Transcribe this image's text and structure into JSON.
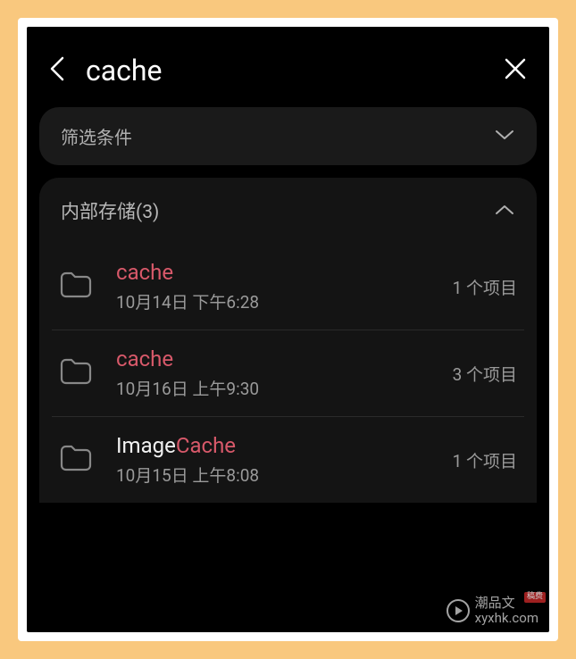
{
  "search": {
    "query": "cache"
  },
  "filter": {
    "label": "筛选条件"
  },
  "storage": {
    "title_prefix": "内部存储",
    "count": "(3)",
    "items": [
      {
        "name_prefix": "",
        "name_highlight": "cache",
        "name_suffix": "",
        "date": "10月14日 下午6:28",
        "count": "1 个项目"
      },
      {
        "name_prefix": "",
        "name_highlight": "cache",
        "name_suffix": "",
        "date": "10月16日 上午9:30",
        "count": "3 个项目"
      },
      {
        "name_prefix": "Image",
        "name_highlight": "Cache",
        "name_suffix": "",
        "date": "10月15日 上午8:08",
        "count": "1 个项目"
      }
    ]
  },
  "watermark": {
    "line1": "潮品文",
    "line2": "xyxhk.com",
    "badge": "稿费"
  }
}
